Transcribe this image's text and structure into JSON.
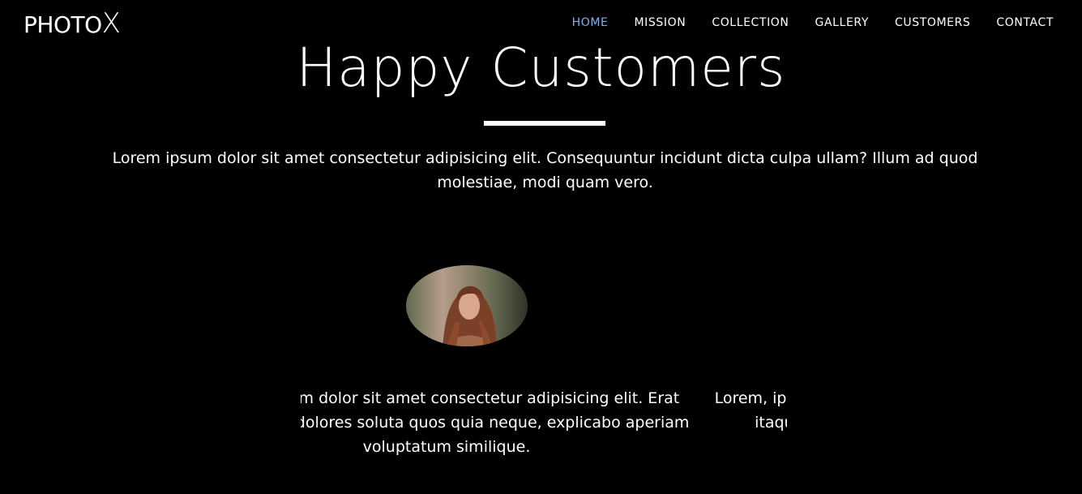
{
  "brand": {
    "logo_main": "PHOTO",
    "logo_accent": "X"
  },
  "nav": {
    "items": [
      {
        "label": "HOME",
        "active": true
      },
      {
        "label": "MISSION",
        "active": false
      },
      {
        "label": "COLLECTION",
        "active": false
      },
      {
        "label": "GALLERY",
        "active": false
      },
      {
        "label": "CUSTOMERS",
        "active": false
      },
      {
        "label": "CONTACT",
        "active": false
      }
    ],
    "active_color": "#7fb0e8"
  },
  "customers": {
    "title": "Happy Customers",
    "intro": "Lorem ipsum dolor sit amet consectetur adipisicing elit. Consequuntur incidunt dicta culpa ullam? Illum ad quod molestiae, modi quam vero.",
    "testimonials": [
      {
        "text": "Lorem ipsum dolor sit amet consectetur adipisicing elit. Erat itaque velit dolores soluta quos quia neque, explicabo aperiam voluptatum similique."
      },
      {
        "text": "Lorem, ipsum dolor sit amet consectetur adipisicing elit. Quaerat itaque velit dolores soluta quos quia neque, explicabo."
      }
    ]
  },
  "colors": {
    "background": "#000000",
    "text": "#ffffff"
  }
}
